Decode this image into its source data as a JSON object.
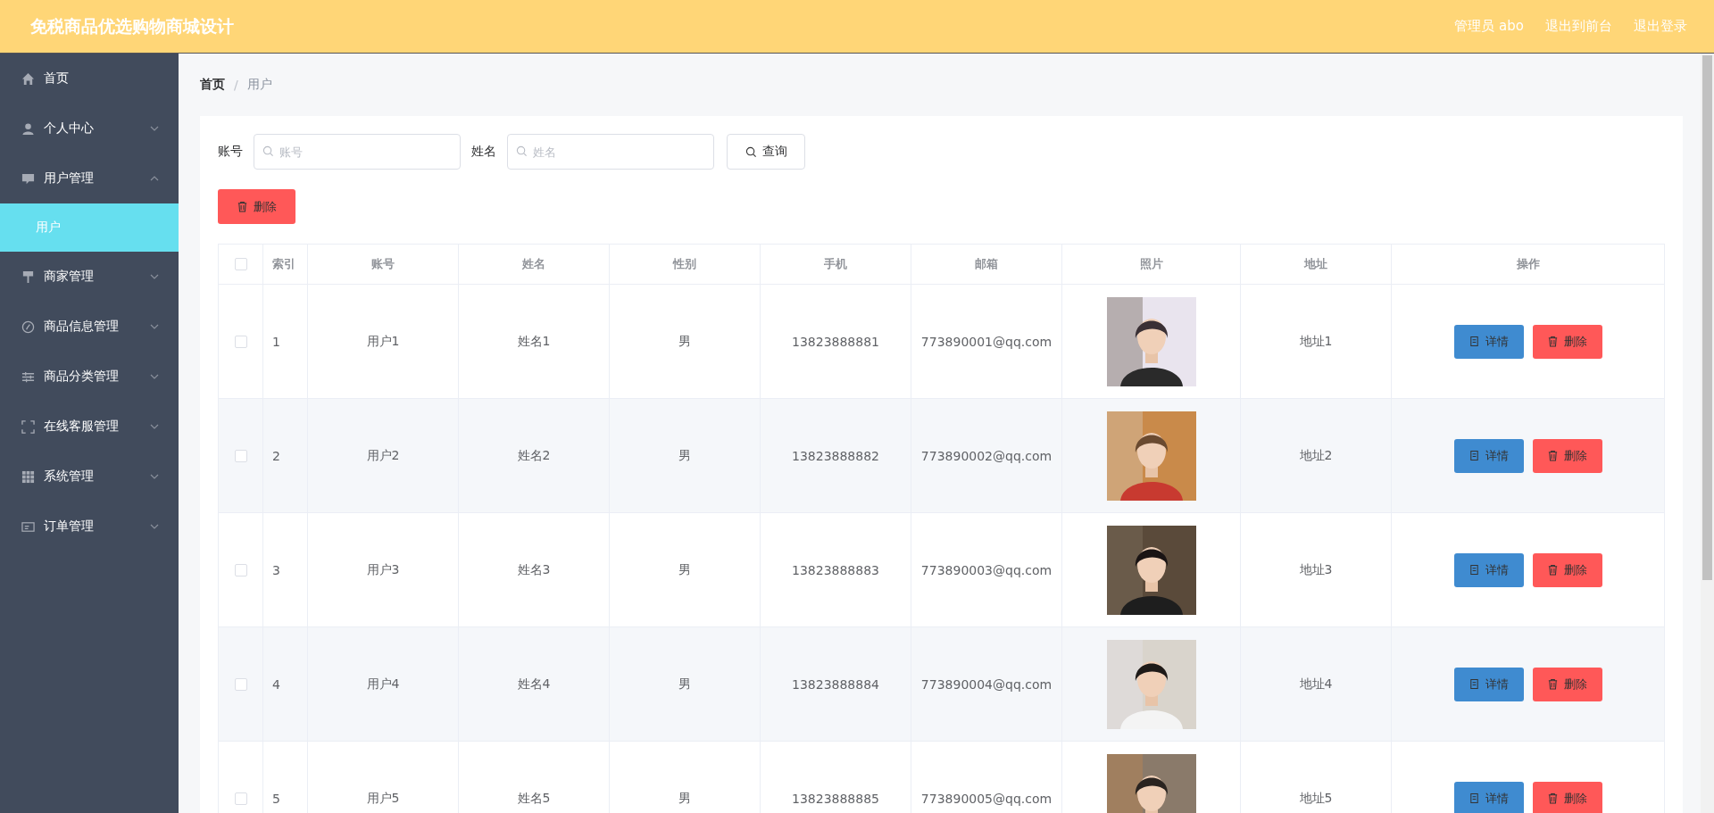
{
  "header": {
    "title": "免税商品优选购物商城设计",
    "links": [
      "管理员 abo",
      "退出到前台",
      "退出登录"
    ]
  },
  "sidebar": {
    "items": [
      {
        "label": "首页"
      },
      {
        "label": "个人中心",
        "expanded": false
      },
      {
        "label": "用户管理",
        "expanded": true,
        "children": [
          {
            "label": "用户",
            "selected": true
          }
        ]
      },
      {
        "label": "商家管理",
        "expanded": false
      },
      {
        "label": "商品信息管理",
        "expanded": false
      },
      {
        "label": "商品分类管理",
        "expanded": false
      },
      {
        "label": "在线客服管理",
        "expanded": false
      },
      {
        "label": "系统管理",
        "expanded": false
      },
      {
        "label": "订单管理",
        "expanded": false
      }
    ]
  },
  "breadcrumb": {
    "separator": "/",
    "items": [
      "首页",
      "用户"
    ]
  },
  "search": {
    "fields": [
      {
        "label": "账号",
        "placeholder": "账号"
      },
      {
        "label": "姓名",
        "placeholder": "姓名"
      }
    ],
    "button": "查询"
  },
  "delete_button": "删除",
  "table": {
    "select_all": {
      "checked": false
    },
    "columns": [
      "索引",
      "账号",
      "姓名",
      "性别",
      "手机",
      "邮箱",
      "照片",
      "地址",
      "操作"
    ],
    "rows": [
      {
        "checked": false,
        "cells": [
          "1",
          "用户1",
          "姓名1",
          "男",
          "13823888881",
          "773890001@qq.com"
        ],
        "photo": {
          "kind": "picture"
        },
        "address": "地址1",
        "actions": [
          {
            "kind": "detail",
            "label": "详情"
          },
          {
            "kind": "delete",
            "label": "删除"
          }
        ]
      },
      {
        "checked": false,
        "cells": [
          "2",
          "用户2",
          "姓名2",
          "男",
          "13823888882",
          "773890002@qq.com"
        ],
        "photo": {
          "kind": "picture"
        },
        "address": "地址2",
        "actions": [
          {
            "kind": "detail",
            "label": "详情"
          },
          {
            "kind": "delete",
            "label": "删除"
          }
        ]
      },
      {
        "checked": false,
        "cells": [
          "3",
          "用户3",
          "姓名3",
          "男",
          "13823888883",
          "773890003@qq.com"
        ],
        "photo": {
          "kind": "picture"
        },
        "address": "地址3",
        "actions": [
          {
            "kind": "detail",
            "label": "详情"
          },
          {
            "kind": "delete",
            "label": "删除"
          }
        ]
      },
      {
        "checked": false,
        "cells": [
          "4",
          "用户4",
          "姓名4",
          "男",
          "13823888884",
          "773890004@qq.com"
        ],
        "photo": {
          "kind": "picture"
        },
        "address": "地址4",
        "actions": [
          {
            "kind": "detail",
            "label": "详情"
          },
          {
            "kind": "delete",
            "label": "删除"
          }
        ]
      },
      {
        "checked": false,
        "cells": [
          "5",
          "用户5",
          "姓名5",
          "男",
          "13823888885",
          "773890005@qq.com"
        ],
        "photo": {
          "kind": "picture"
        },
        "address": "地址5",
        "actions": [
          {
            "kind": "detail",
            "label": "详情"
          },
          {
            "kind": "delete",
            "label": "删除"
          }
        ]
      }
    ]
  }
}
